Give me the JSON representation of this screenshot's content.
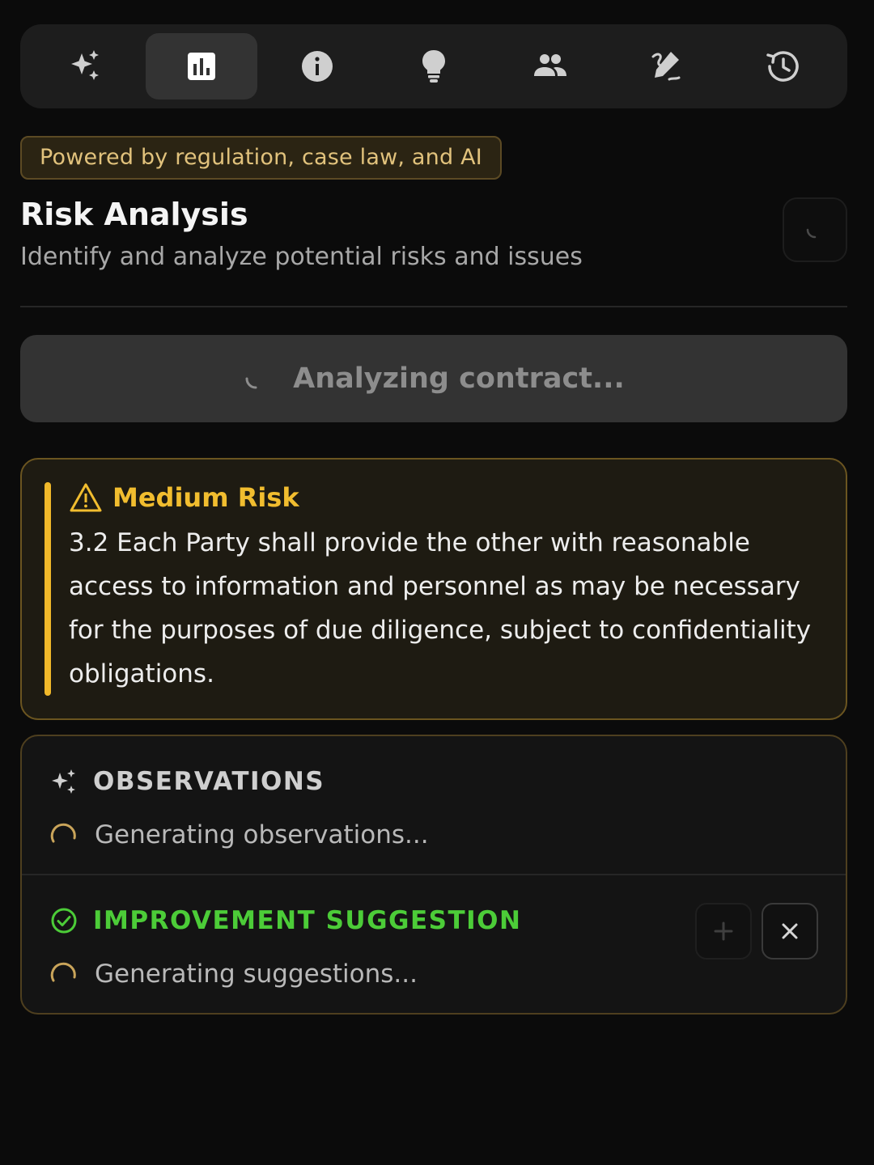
{
  "tabs": [
    {
      "icon": "sparkles-icon",
      "active": false
    },
    {
      "icon": "bar-chart-icon",
      "active": true
    },
    {
      "icon": "info-icon",
      "active": false
    },
    {
      "icon": "lightbulb-icon",
      "active": false
    },
    {
      "icon": "people-icon",
      "active": false
    },
    {
      "icon": "draw-icon",
      "active": false
    },
    {
      "icon": "history-icon",
      "active": false
    }
  ],
  "badge": "Powered by regulation, case law, and AI",
  "header": {
    "title": "Risk Analysis",
    "subtitle": "Identify and analyze potential risks and issues"
  },
  "analyzing": {
    "label": "Analyzing contract..."
  },
  "risk": {
    "level": "Medium Risk",
    "clause": "3.2 Each Party shall provide the other with reasonable access to information and personnel as may be necessary for the purposes of due diligence, subject to confidentiality obligations.",
    "accent_color": "#f0b82a"
  },
  "observations": {
    "title": "OBSERVATIONS",
    "loading": "Generating observations..."
  },
  "improvement": {
    "title": "IMPROVEMENT SUGGESTION",
    "loading": "Generating suggestions...",
    "accent_color": "#4ccc38"
  }
}
